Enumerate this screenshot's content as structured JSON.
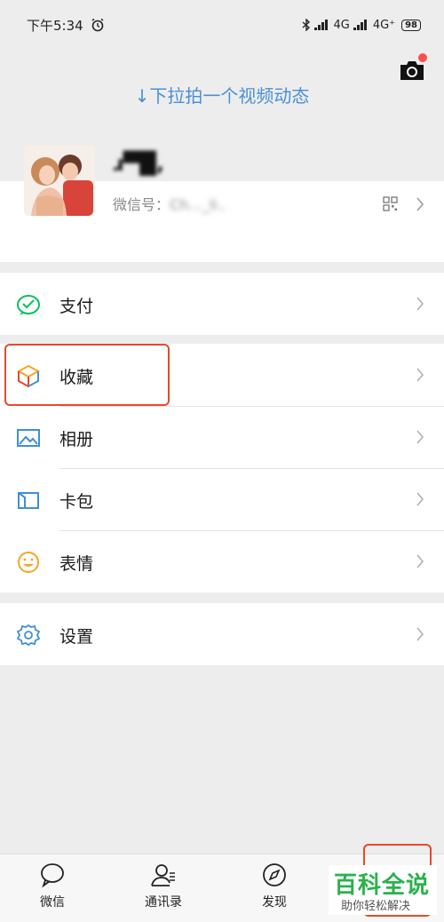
{
  "status_bar": {
    "time": "下午5:34",
    "network1": "4G",
    "network2": "4G⁺",
    "battery": "98"
  },
  "header": {
    "pull_hint": "↓下拉拍一个视频动态"
  },
  "profile": {
    "nickname": "ɹ▀█,",
    "wechat_id_label": "微信号：",
    "wechat_id_value": "Ch..._li.."
  },
  "menu": {
    "pay_label": "支付",
    "favorites_label": "收藏",
    "album_label": "相册",
    "cards_label": "卡包",
    "stickers_label": "表情",
    "settings_label": "设置"
  },
  "tabbar": {
    "chats": "微信",
    "contacts": "通讯录",
    "discover": "发现"
  },
  "watermark": {
    "title": "百科全说",
    "subtitle": "助你轻松解决"
  },
  "colors": {
    "accent_blue": "#4a8fd4",
    "highlight_red": "#e64a2e",
    "pay_green": "#07c160",
    "watermark_green": "#2bb24c"
  }
}
